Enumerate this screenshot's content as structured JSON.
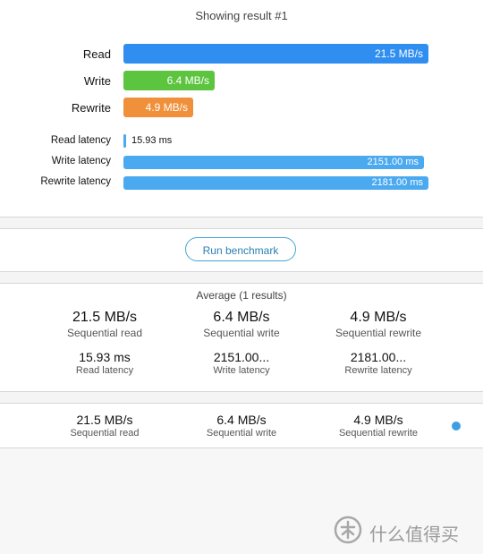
{
  "result": {
    "title": "Showing result #1",
    "bars": {
      "read_label": "Read",
      "read_value": "21.5 MB/s",
      "write_label": "Write",
      "write_value": "6.4 MB/s",
      "rewrite_label": "Rewrite",
      "rewrite_value": "4.9 MB/s"
    },
    "latency": {
      "read_label": "Read latency",
      "read_value": "15.93 ms",
      "write_label": "Write latency",
      "write_value": "2151.00 ms",
      "rewrite_label": "Rewrite latency",
      "rewrite_value": "2181.00 ms"
    },
    "levels": {
      "read_mbps": 21.5,
      "write_mbps": 6.4,
      "rewrite_mbps": 4.9,
      "read_latency_ms": 15.93,
      "write_latency_ms": 2151.0,
      "rewrite_latency_ms": 2181.0
    }
  },
  "run_button_label": "Run benchmark",
  "average": {
    "title": "Average (1 results)",
    "seq_read_value": "21.5 MB/s",
    "seq_read_label": "Sequential read",
    "seq_write_value": "6.4 MB/s",
    "seq_write_label": "Sequential write",
    "seq_rewrite_value": "4.9 MB/s",
    "seq_rewrite_label": "Sequential rewrite",
    "read_lat_value": "15.93 ms",
    "read_lat_label": "Read latency",
    "write_lat_value": "2151.00...",
    "write_lat_label": "Write latency",
    "rewrite_lat_value": "2181.00...",
    "rewrite_lat_label": "Rewrite latency"
  },
  "history_row": {
    "seq_read_value": "21.5 MB/s",
    "seq_read_label": "Sequential read",
    "seq_write_value": "6.4 MB/s",
    "seq_write_label": "Sequential write",
    "seq_rewrite_value": "4.9 MB/s",
    "seq_rewrite_label": "Sequential rewrite"
  },
  "colors": {
    "read": "#2f8ef0",
    "write": "#5cc43e",
    "rewrite": "#f0903a",
    "latency": "#4aa9ef",
    "accent": "#3c9ee5"
  },
  "watermark": {
    "text": "什么值得买",
    "icon": "zhide-mai-logo-icon"
  }
}
